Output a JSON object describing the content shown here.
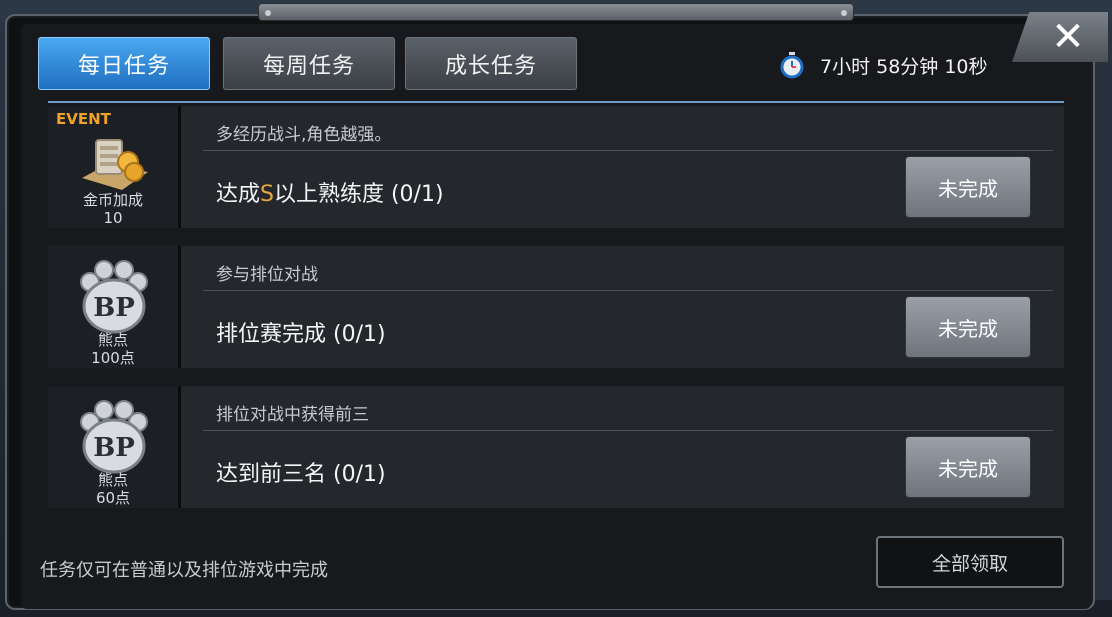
{
  "tabs": [
    {
      "label": "每日任务",
      "active": true
    },
    {
      "label": "每周任务",
      "active": false
    },
    {
      "label": "成长任务",
      "active": false
    }
  ],
  "timer": {
    "text": "7小时 58分钟 10秒",
    "icon": "stopwatch-icon"
  },
  "close_icon": "close-icon",
  "quests": [
    {
      "title": "多经历战斗,角色越强。",
      "desc_before": "达成",
      "desc_highlight": "S",
      "desc_after": "以上熟练度 (0/1)",
      "badge": "EVENT",
      "reward_icon": "gold-coins-icon",
      "reward_name": "金币加成",
      "reward_amount": "10",
      "status": "未完成"
    },
    {
      "title": "参与排位对战",
      "desc": "排位赛完成 (0/1)",
      "reward_icon": "bp-paw-icon",
      "reward_icon_text": "BP",
      "reward_name": "熊点",
      "reward_amount": "100点",
      "status": "未完成"
    },
    {
      "title": "排位对战中获得前三",
      "desc": "达到前三名 (0/1)",
      "reward_icon": "bp-paw-icon",
      "reward_icon_text": "BP",
      "reward_name": "熊点",
      "reward_amount": "60点",
      "status": "未完成"
    }
  ],
  "footer": {
    "note": "任务仅可在普通以及排位游戏中完成",
    "claim_all": "全部领取"
  },
  "colors": {
    "active_tab": "#2f8ee0",
    "highlight": "#e7a63b",
    "divider": "#6d9ac8"
  }
}
